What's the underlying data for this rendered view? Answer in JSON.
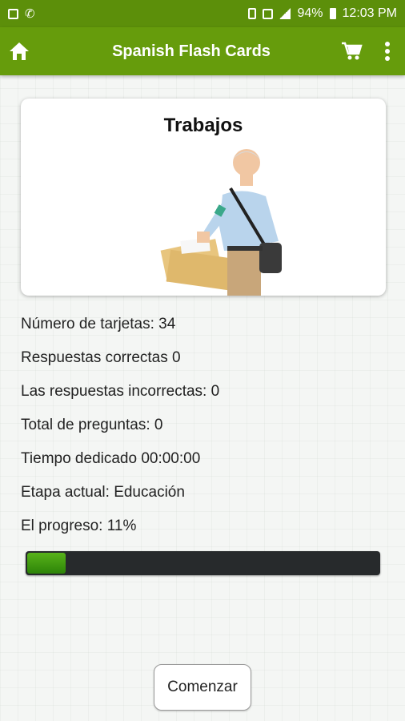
{
  "status_bar": {
    "battery": "94%",
    "time": "12:03 PM"
  },
  "app_bar": {
    "title": "Spanish Flash Cards",
    "icons": [
      "home-icon",
      "cart-icon",
      "more-vert-icon"
    ]
  },
  "card": {
    "title": "Trabajos",
    "image": "mail-carrier-photo"
  },
  "info": {
    "num_cards": "Número de tarjetas: 34",
    "correct": "Respuestas correctas 0",
    "incorrect": "Las respuestas incorrectas: 0",
    "total_questions": "Total de preguntas: 0",
    "time_spent": "Tiempo dedicado 00:00:00",
    "current_stage": "Etapa actual: Educación",
    "progress_label": "El progreso: 11%"
  },
  "progress": {
    "percent": 11,
    "color": "#3a9810"
  },
  "start_button": {
    "label": "Comenzar"
  },
  "colors": {
    "status_bar": "#5c8f0a",
    "app_bar": "#669c0c"
  }
}
